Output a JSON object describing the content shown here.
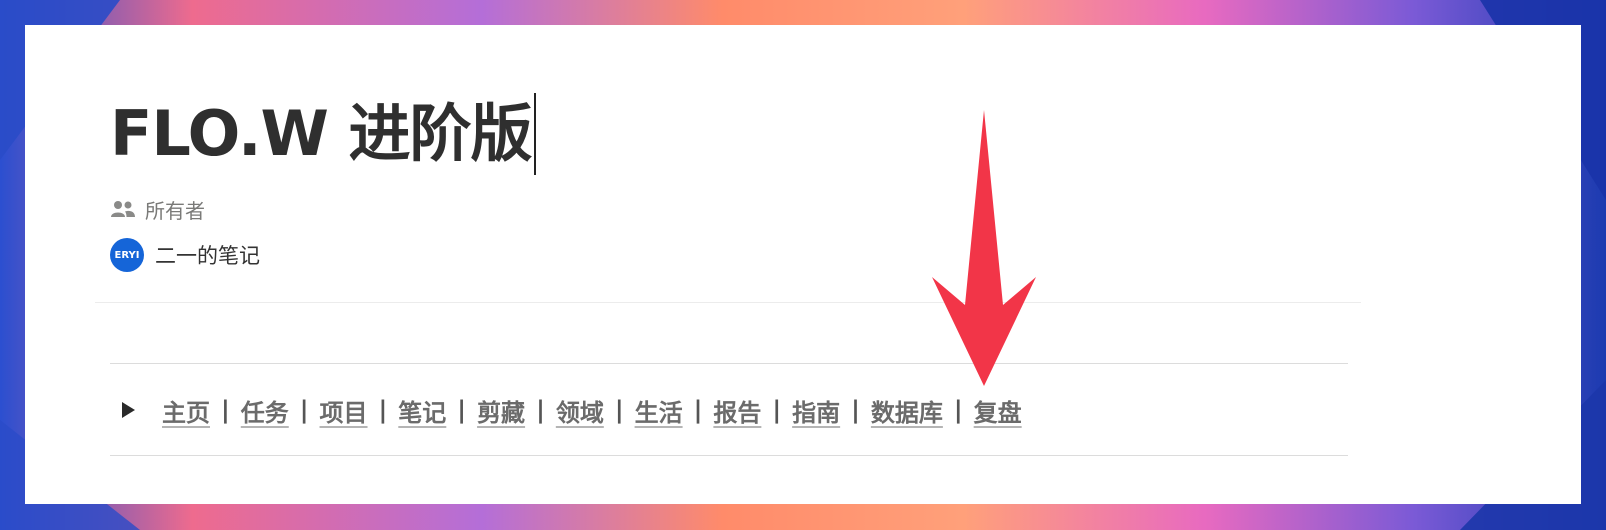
{
  "page": {
    "title": "FLO.W 进阶版",
    "property_label": "所有者",
    "owner": {
      "avatar_text": "ERYI",
      "name": "二一的笔记"
    }
  },
  "toggle": {
    "links": [
      {
        "label": "主页"
      },
      {
        "label": "任务"
      },
      {
        "label": "项目"
      },
      {
        "label": "笔记"
      },
      {
        "label": "剪藏"
      },
      {
        "label": "领域"
      },
      {
        "label": "生活"
      },
      {
        "label": "报告"
      },
      {
        "label": "指南"
      },
      {
        "label": "数据库"
      },
      {
        "label": "复盘"
      }
    ],
    "separator": "|"
  },
  "colors": {
    "title": "#2f2f2f",
    "link": "#6b6b6b",
    "avatar": "#1565d8",
    "arrow": "#f23548"
  },
  "icons": {
    "property": "people-icon",
    "toggle": "triangle-right-icon",
    "annotation": "red-arrow-down-icon"
  }
}
